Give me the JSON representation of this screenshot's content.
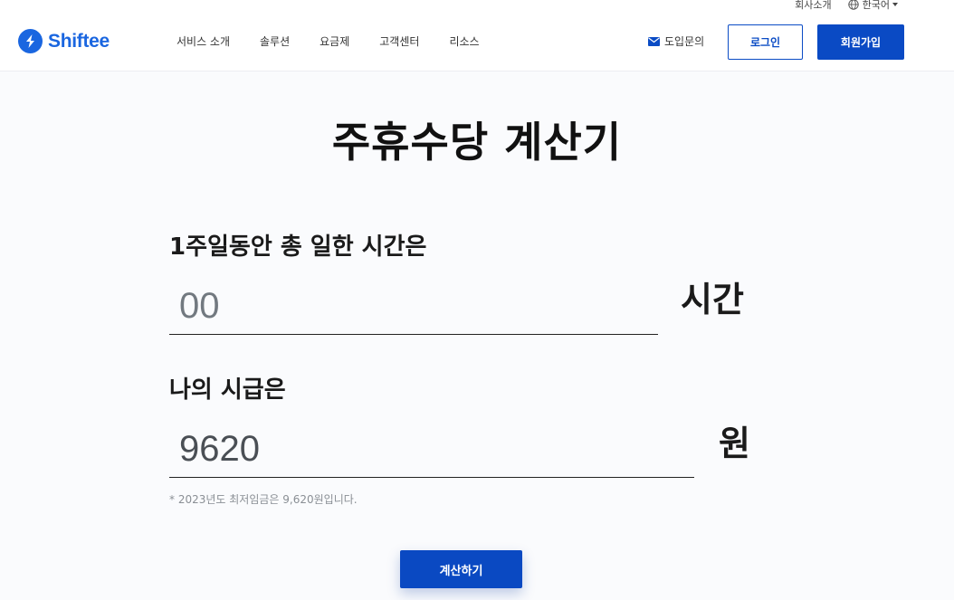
{
  "header": {
    "util": {
      "company": "회사소개",
      "language": "한국어"
    },
    "logo": {
      "text": "Shiftee"
    },
    "nav": [
      "서비스 소개",
      "솔루션",
      "요금제",
      "고객센터",
      "리소스"
    ],
    "inquiry": "도입문의",
    "login": "로그인",
    "signup": "회원가입"
  },
  "main": {
    "title": "주휴수당 계산기",
    "hours": {
      "label": "1주일동안 총 일한 시간은",
      "placeholder": "00",
      "value": "",
      "unit": "시간"
    },
    "wage": {
      "label": "나의 시급은",
      "value": "9620",
      "unit": "원"
    },
    "note": "* 2023년도 최저임금은 9,620원입니다.",
    "calculate": "계산하기"
  },
  "colors": {
    "brand": "#1a66e0",
    "primary_button": "#0a4ac4"
  }
}
